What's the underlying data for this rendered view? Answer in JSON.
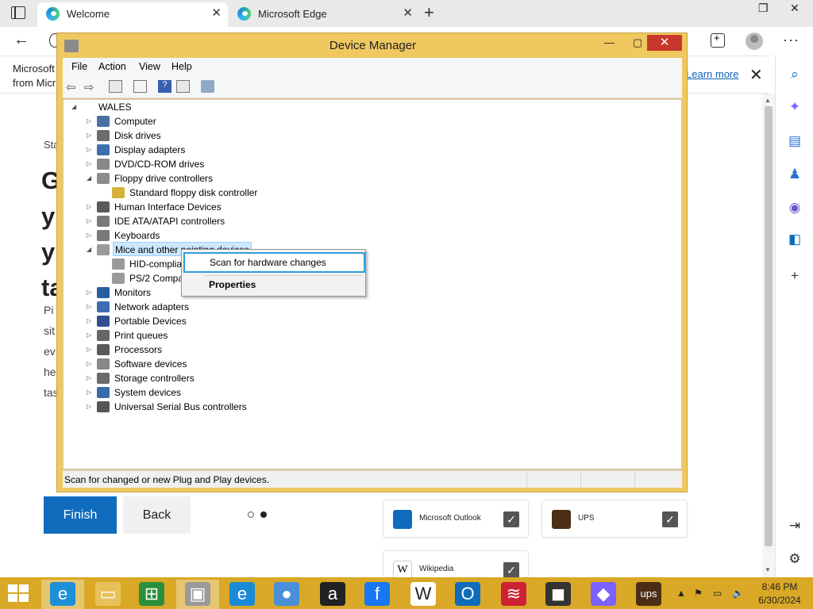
{
  "browser": {
    "tabs": [
      {
        "title": "Welcome",
        "active": true
      },
      {
        "title": "Microsoft Edge",
        "active": false
      }
    ],
    "new_tab_glyph": "+",
    "window_controls": {
      "minimize": "—",
      "restore": "❐",
      "close": "✕"
    },
    "more_glyph": "···",
    "notice": {
      "line1": "Microsoft",
      "line2": "from Micr",
      "learn_more": "Learn more"
    }
  },
  "page": {
    "small_text": "Sta",
    "heading_lines": [
      "G",
      "y",
      "y",
      "ta"
    ],
    "body_lines": [
      "Pi",
      "sit",
      "ev",
      "he",
      "tas"
    ],
    "finish_label": "Finish",
    "back_label": "Back",
    "cards": [
      {
        "label": "Microsoft Outlook",
        "icon": "outlook-icon",
        "checked": true
      },
      {
        "label": "UPS",
        "icon": "ups-icon",
        "checked": true
      },
      {
        "label": "Wikipedia",
        "icon": "wikipedia-icon",
        "checked": true
      }
    ]
  },
  "device_manager": {
    "title": "Device Manager",
    "menu": [
      "File",
      "Action",
      "View",
      "Help"
    ],
    "root": "WALES",
    "nodes": [
      {
        "label": "Computer",
        "expanded": false,
        "level": 1
      },
      {
        "label": "Disk drives",
        "expanded": false,
        "level": 1
      },
      {
        "label": "Display adapters",
        "expanded": false,
        "level": 1
      },
      {
        "label": "DVD/CD-ROM drives",
        "expanded": false,
        "level": 1
      },
      {
        "label": "Floppy drive controllers",
        "expanded": true,
        "level": 1
      },
      {
        "label": "Standard floppy disk controller",
        "level": 2
      },
      {
        "label": "Human Interface Devices",
        "expanded": false,
        "level": 1
      },
      {
        "label": "IDE ATA/ATAPI controllers",
        "expanded": false,
        "level": 1
      },
      {
        "label": "Keyboards",
        "expanded": false,
        "level": 1
      },
      {
        "label": "Mice and other pointing devices",
        "expanded": true,
        "level": 1,
        "selected": true
      },
      {
        "label": "HID-complia",
        "level": 2
      },
      {
        "label": "PS/2 Compa",
        "level": 2
      },
      {
        "label": "Monitors",
        "expanded": false,
        "level": 1
      },
      {
        "label": "Network adapters",
        "expanded": false,
        "level": 1
      },
      {
        "label": "Portable Devices",
        "expanded": false,
        "level": 1
      },
      {
        "label": "Print queues",
        "expanded": false,
        "level": 1
      },
      {
        "label": "Processors",
        "expanded": false,
        "level": 1
      },
      {
        "label": "Software devices",
        "expanded": false,
        "level": 1
      },
      {
        "label": "Storage controllers",
        "expanded": false,
        "level": 1
      },
      {
        "label": "System devices",
        "expanded": false,
        "level": 1
      },
      {
        "label": "Universal Serial Bus controllers",
        "expanded": false,
        "level": 1
      }
    ],
    "status": "Scan for changed or new Plug and Play devices.",
    "context_menu": {
      "scan": "Scan for hardware changes",
      "properties": "Properties"
    }
  },
  "taskbar": {
    "apps": [
      {
        "name": "internet-explorer-icon",
        "glyph": "e",
        "color": "#1e90d8"
      },
      {
        "name": "file-explorer-icon",
        "glyph": "▭",
        "color": "#e8c15a"
      },
      {
        "name": "store-icon",
        "glyph": "⊞",
        "color": "#2a8f3c"
      },
      {
        "name": "device-manager-icon",
        "glyph": "▣",
        "color": "#9a9a9a"
      },
      {
        "name": "edge-icon",
        "glyph": "e",
        "color": "#1b8bd8"
      },
      {
        "name": "help-icon",
        "glyph": "●",
        "color": "#4a90d9"
      },
      {
        "name": "amazon-icon",
        "glyph": "a",
        "color": "#222222"
      },
      {
        "name": "facebook-icon",
        "glyph": "f",
        "color": "#1877f2"
      },
      {
        "name": "wikipedia-icon",
        "glyph": "W",
        "color": "#ffffff"
      },
      {
        "name": "outlook-icon",
        "glyph": "O",
        "color": "#0f6cbd"
      },
      {
        "name": "bank-of-america-icon",
        "glyph": "≋",
        "color": "#cc2233"
      },
      {
        "name": "shopping-icon",
        "glyph": "◼",
        "color": "#333333"
      },
      {
        "name": "copilot-icon",
        "glyph": "◆",
        "color": "#7b61ff"
      },
      {
        "name": "ups-icon",
        "glyph": "ups",
        "color": "#4b2e14"
      }
    ],
    "time": "8:46 PM",
    "date": "6/30/2024"
  }
}
